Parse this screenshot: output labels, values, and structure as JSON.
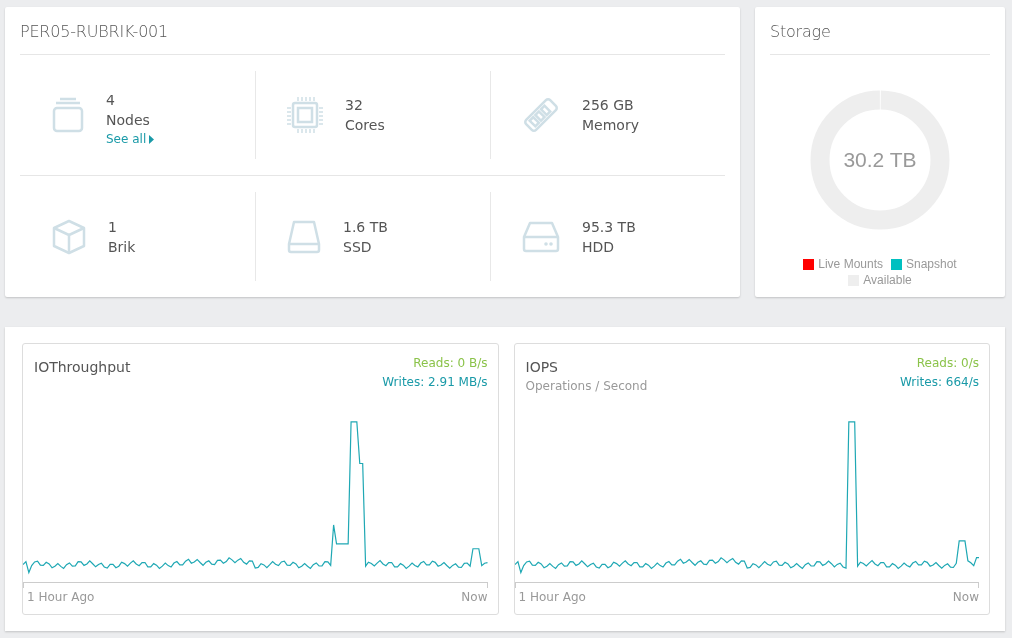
{
  "cluster": {
    "title": "PER05-RUBRIK-001",
    "stats": [
      {
        "kind": "nodes",
        "value": "4",
        "label": "Nodes",
        "link": "See all"
      },
      {
        "kind": "cores",
        "value": "32",
        "label": "Cores"
      },
      {
        "kind": "memory",
        "value": "256 GB",
        "label": "Memory"
      },
      {
        "kind": "brik",
        "value": "1",
        "label": "Brik"
      },
      {
        "kind": "ssd",
        "value": "1.6 TB",
        "label": "SSD"
      },
      {
        "kind": "hdd",
        "value": "95.3 TB",
        "label": "HDD"
      }
    ]
  },
  "storage": {
    "title": "Storage",
    "total": "30.2 TB",
    "legend": [
      {
        "label": "Live Mounts",
        "color": "#ff0000"
      },
      {
        "label": "Snapshot",
        "color": "#00c0c0"
      },
      {
        "label": "Available",
        "color": "#eeeeee"
      }
    ]
  },
  "charts": [
    {
      "kind": "throughput",
      "title": "IOThroughput",
      "reads": "Reads: 0 B/s",
      "writes": "Writes: 2.91 MB/s",
      "start": "1 Hour Ago",
      "end": "Now"
    },
    {
      "kind": "iops",
      "title": "IOPS",
      "subtitle": "Operations / Second",
      "reads": "Reads: 0/s",
      "writes": "Writes: 664/s",
      "start": "1 Hour Ago",
      "end": "Now"
    }
  ]
}
